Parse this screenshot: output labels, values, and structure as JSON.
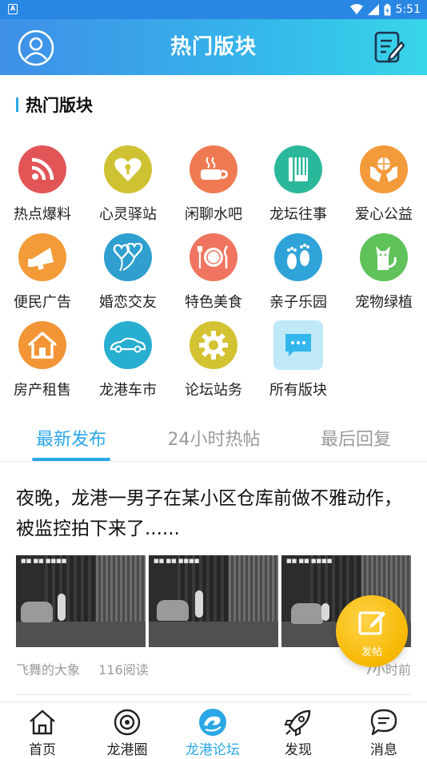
{
  "status_bar": {
    "time": "5:51"
  },
  "header": {
    "title": "热门版块"
  },
  "section": {
    "title": "热门版块"
  },
  "categories": [
    {
      "label": "热点爆料",
      "icon": "rss-icon",
      "color": "#e25557"
    },
    {
      "label": "心灵驿站",
      "icon": "heart-lock-icon",
      "color": "#cfc232"
    },
    {
      "label": "闲聊水吧",
      "icon": "coffee-cup-icon",
      "color": "#ef7a52"
    },
    {
      "label": "龙坛往事",
      "icon": "book-icon",
      "color": "#2bb89a"
    },
    {
      "label": "爱心公益",
      "icon": "charity-hands-icon",
      "color": "#f39a3a"
    },
    {
      "label": "便民广告",
      "icon": "megaphone-icon",
      "color": "#f29b38"
    },
    {
      "label": "婚恋交友",
      "icon": "balloon-hearts-icon",
      "color": "#2f9fd0"
    },
    {
      "label": "特色美食",
      "icon": "plate-cutlery-icon",
      "color": "#ef7560"
    },
    {
      "label": "亲子乐园",
      "icon": "footprints-icon",
      "color": "#2fa3d8"
    },
    {
      "label": "宠物绿植",
      "icon": "cat-icon",
      "color": "#5fc25a"
    },
    {
      "label": "房产租售",
      "icon": "house-icon",
      "color": "#f29537"
    },
    {
      "label": "龙港车市",
      "icon": "car-icon",
      "color": "#27aed0"
    },
    {
      "label": "论坛站务",
      "icon": "gear-icon",
      "color": "#d3c232"
    },
    {
      "label": "所有版块",
      "icon": "chat-bubble-icon",
      "color": "#bfe9f9"
    }
  ],
  "tabs": [
    {
      "label": "最新发布",
      "active": true
    },
    {
      "label": "24小时热帖",
      "active": false
    },
    {
      "label": "最后回复",
      "active": false
    }
  ],
  "post": {
    "title": "夜晚，龙港一男子在某小区仓库前做不雅动作，被监控拍下来了......",
    "author": "飞舞的大象",
    "reads": "116阅读",
    "time": "7小时前"
  },
  "fab": {
    "label": "发帖"
  },
  "bottom_nav": [
    {
      "label": "首页",
      "icon": "home-icon",
      "active": false
    },
    {
      "label": "龙港圈",
      "icon": "circle-icon",
      "active": false
    },
    {
      "label": "龙港论坛",
      "icon": "forum-logo-icon",
      "active": true
    },
    {
      "label": "发现",
      "icon": "rocket-icon",
      "active": false
    },
    {
      "label": "消息",
      "icon": "message-icon",
      "active": false
    }
  ],
  "colors": {
    "accent": "#2aa7e6",
    "fab": "#f6b800"
  }
}
